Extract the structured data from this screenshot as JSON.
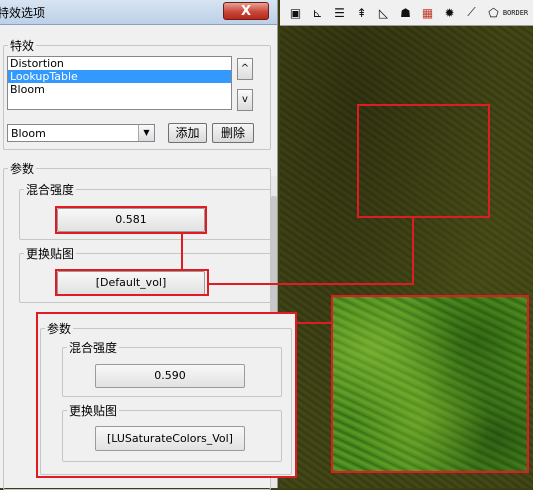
{
  "window": {
    "title": "特效选项",
    "close_label": "X"
  },
  "effects_group": {
    "legend": "特效",
    "items": [
      "Distortion",
      "LookupTable",
      "Bloom"
    ],
    "selected_index": 1,
    "up_label": "^",
    "down_label": "v",
    "combo_value": "Bloom",
    "add_label": "添加",
    "delete_label": "删除"
  },
  "params": {
    "legend": "参数",
    "blend": {
      "legend": "混合强度",
      "value": "0.581"
    },
    "texture": {
      "legend": "更换贴图",
      "value": "[Default_vol]"
    }
  },
  "callout": {
    "legend": "参数",
    "blend": {
      "legend": "混合强度",
      "value": "0.590"
    },
    "texture": {
      "legend": "更换贴图",
      "value": "[LUSaturateColors_Vol]"
    }
  },
  "toolbar": {
    "icons": [
      "display-icon",
      "axes-icon",
      "lines-icon",
      "tree-icon",
      "triangle-icon",
      "light-icon",
      "map-icon",
      "splat-icon",
      "node-icon",
      "loop-icon",
      "border-icon"
    ],
    "border_label_top": "BOR",
    "border_label_bottom": "DER"
  },
  "colors": {
    "highlight": "#e01b24",
    "selection": "#3399ff"
  }
}
